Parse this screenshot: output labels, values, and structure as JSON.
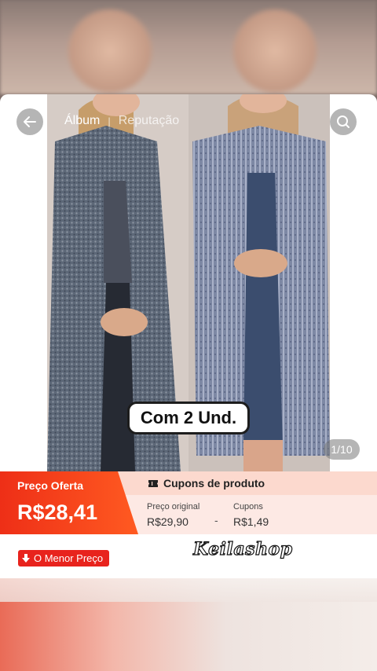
{
  "nav": {
    "tab_album": "Álbum",
    "tab_separator": "|",
    "tab_reputation": "Reputação",
    "back_icon": "arrow-left-icon",
    "search_icon": "search-icon"
  },
  "image": {
    "caption": "Com 2 Und.",
    "page_counter": "1/10"
  },
  "price": {
    "label": "Preço Oferta",
    "value": "R$28,41",
    "accent": "#ee2f17"
  },
  "coupons": {
    "header": "Cupons de produto",
    "original_label": "Preço original",
    "original_value": "R$29,90",
    "minus": "-",
    "coupon_label": "Cupons",
    "coupon_value": "R$1,49"
  },
  "footer": {
    "lowest_price_badge": "O Menor Preço",
    "shop_name": "Keilashop"
  }
}
